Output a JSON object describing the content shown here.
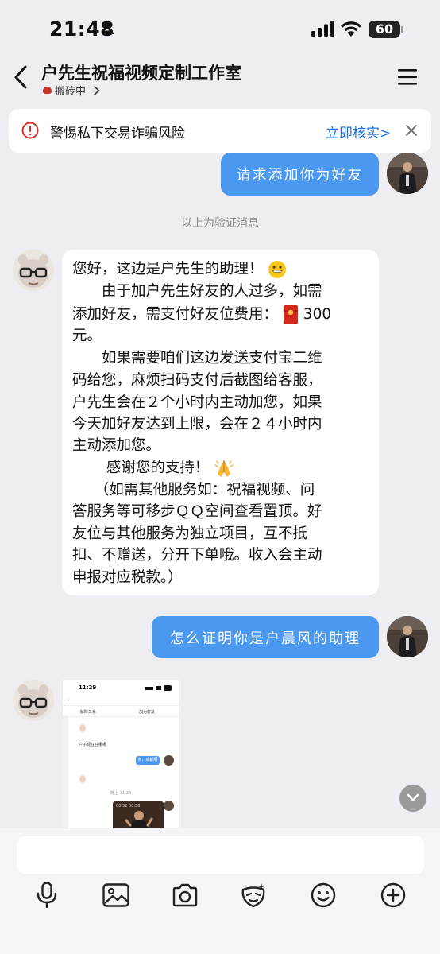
{
  "status": {
    "time": "21:48",
    "battery": "60",
    "battery_level": 0.6
  },
  "nav": {
    "title": "户先生祝福视频定制工作室",
    "subtitle": "搬砖中"
  },
  "warning": {
    "text": "警惕私下交易诈骗风险",
    "link": "立即核实>"
  },
  "messages": {
    "outgoing_1": "请求添加你为好友",
    "system": "以上为验证消息",
    "incoming_lines": [
      "您好，这边是户先生的助理！",
      "　　由于加户先生好友的人过多，如需",
      "添加好友，需支付好友位费用：",
      "300",
      "元。",
      "　　如果需要咱们这边发送支付宝二维",
      "码给您，麻烦扫码支付后截图给客服，",
      "户先生会在２个小时内主动加您，如果",
      "今天加好友达到上限，会在２４小时内",
      "主动添加您。",
      "　　 感谢您的支持！",
      "　　（如需其他服务如：祝福视频、问",
      "答服务等可移步ＱＱ空间查看置顶。好",
      "友位与其他服务为独立项目，互不抵",
      "扣、不赠送，分开下单哦。收入会主动",
      "申报对应税款。）"
    ],
    "outgoing_2": "怎么证明你是户晨风的助理"
  },
  "thumbnail": {
    "time": "11:29",
    "btn_left": "解除关系",
    "btn_right": "加为好友",
    "line_1": "户子现在在哪呢",
    "bubble": "亲，成都啊",
    "line_2": "晚上 11:28",
    "video_label": "00:32 00:58"
  },
  "icons": [
    "person-icon",
    "signal-icon",
    "wifi-icon",
    "back-icon",
    "menu-icon",
    "warning-icon",
    "close-icon",
    "chevron-down-icon",
    "mic-icon",
    "image-icon",
    "camera-icon",
    "sticker-icon",
    "emoji-icon",
    "plus-icon"
  ],
  "colors": {
    "accent": "#4a98f0",
    "link": "#1a73e8",
    "warning": "#d93025",
    "background": "#eeeef2"
  }
}
